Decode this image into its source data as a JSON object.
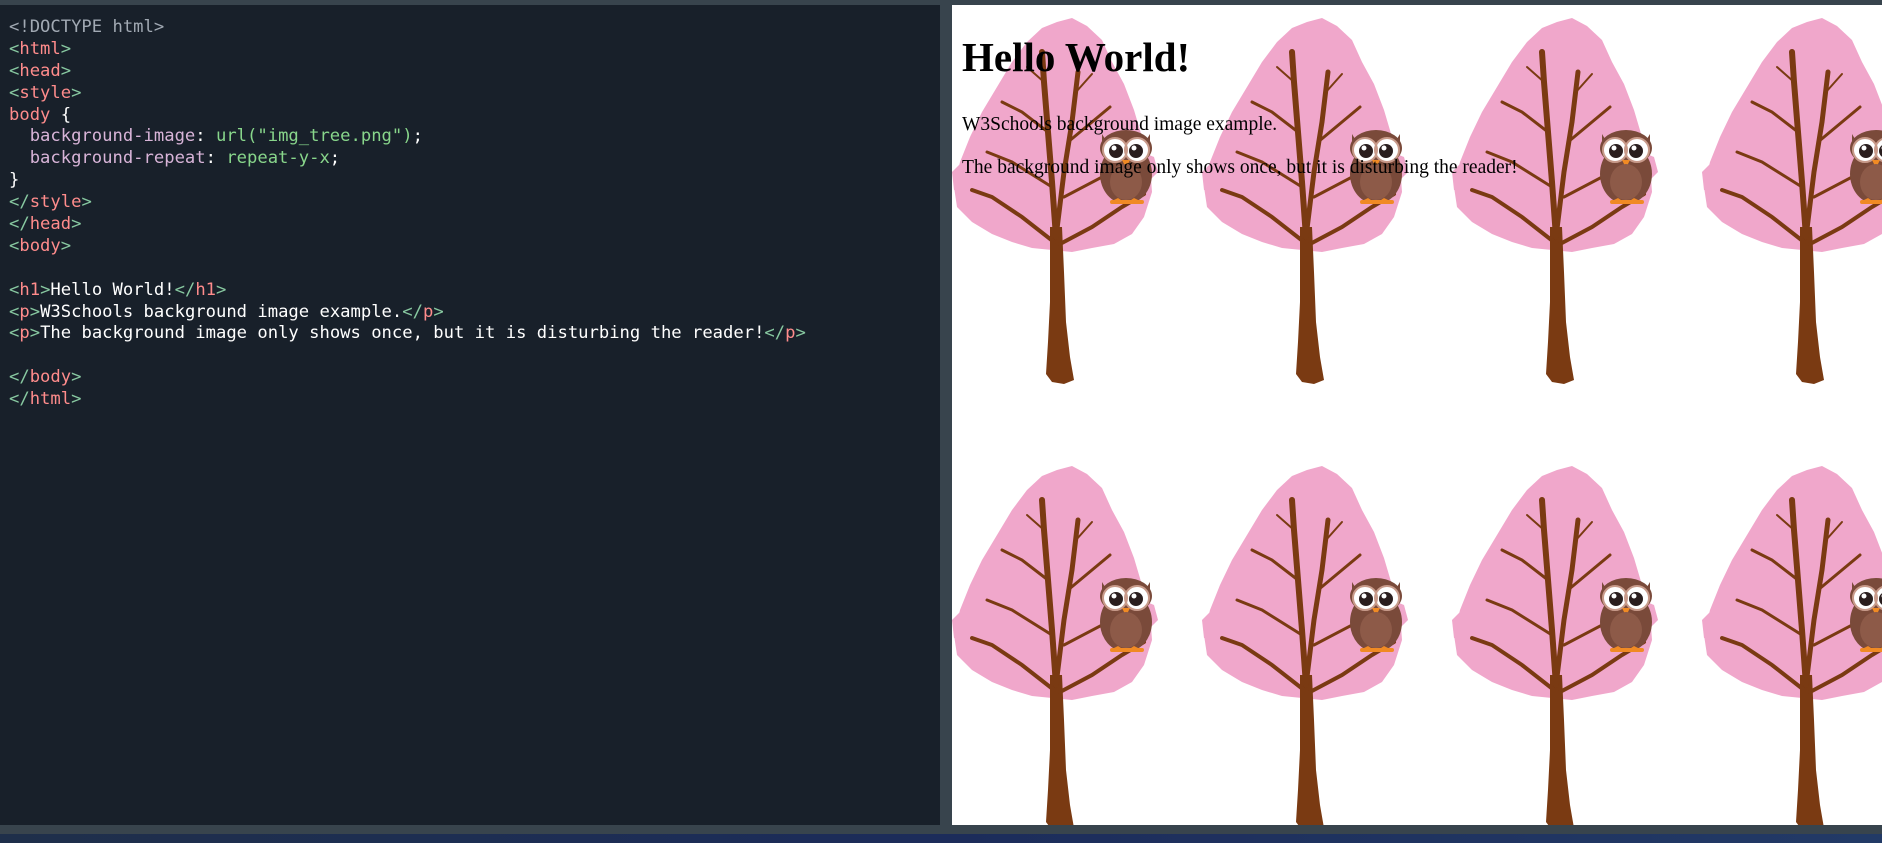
{
  "editor": {
    "lines": [
      [
        {
          "c": "t-doctype",
          "t": "<!DOCTYPE html>"
        }
      ],
      [
        {
          "c": "t-bracket",
          "t": "<"
        },
        {
          "c": "t-tag",
          "t": "html"
        },
        {
          "c": "t-bracket",
          "t": ">"
        }
      ],
      [
        {
          "c": "t-bracket",
          "t": "<"
        },
        {
          "c": "t-tag",
          "t": "head"
        },
        {
          "c": "t-bracket",
          "t": ">"
        }
      ],
      [
        {
          "c": "t-bracket",
          "t": "<"
        },
        {
          "c": "t-tag",
          "t": "style"
        },
        {
          "c": "t-bracket",
          "t": ">"
        }
      ],
      [
        {
          "c": "t-sel",
          "t": "body"
        },
        {
          "c": "t-punc",
          "t": " {"
        }
      ],
      [
        {
          "c": "t-prop",
          "t": "  background-image"
        },
        {
          "c": "t-punc",
          "t": ": "
        },
        {
          "c": "t-val",
          "t": "url("
        },
        {
          "c": "t-val",
          "t": "\"img_tree.png\""
        },
        {
          "c": "t-val",
          "t": ")"
        },
        {
          "c": "t-punc",
          "t": ";"
        }
      ],
      [
        {
          "c": "t-prop",
          "t": "  background-repeat"
        },
        {
          "c": "t-punc",
          "t": ": "
        },
        {
          "c": "t-val",
          "t": "repeat-y-x"
        },
        {
          "c": "t-punc",
          "t": ";"
        }
      ],
      [
        {
          "c": "t-punc",
          "t": "}"
        }
      ],
      [
        {
          "c": "t-bracket",
          "t": "</"
        },
        {
          "c": "t-tag",
          "t": "style"
        },
        {
          "c": "t-bracket",
          "t": ">"
        }
      ],
      [
        {
          "c": "t-bracket",
          "t": "</"
        },
        {
          "c": "t-tag",
          "t": "head"
        },
        {
          "c": "t-bracket",
          "t": ">"
        }
      ],
      [
        {
          "c": "t-bracket",
          "t": "<"
        },
        {
          "c": "t-tag",
          "t": "body"
        },
        {
          "c": "t-bracket",
          "t": ">"
        }
      ],
      [],
      [
        {
          "c": "t-bracket",
          "t": "<"
        },
        {
          "c": "t-tag",
          "t": "h1"
        },
        {
          "c": "t-bracket",
          "t": ">"
        },
        {
          "c": "t-text",
          "t": "Hello World!"
        },
        {
          "c": "t-bracket",
          "t": "</"
        },
        {
          "c": "t-tag",
          "t": "h1"
        },
        {
          "c": "t-bracket",
          "t": ">"
        }
      ],
      [
        {
          "c": "t-bracket",
          "t": "<"
        },
        {
          "c": "t-tag",
          "t": "p"
        },
        {
          "c": "t-bracket",
          "t": ">"
        },
        {
          "c": "t-text",
          "t": "W3Schools background image example."
        },
        {
          "c": "t-bracket",
          "t": "</"
        },
        {
          "c": "t-tag",
          "t": "p"
        },
        {
          "c": "t-bracket",
          "t": ">"
        }
      ],
      [
        {
          "c": "t-bracket",
          "t": "<"
        },
        {
          "c": "t-tag",
          "t": "p"
        },
        {
          "c": "t-bracket",
          "t": ">"
        },
        {
          "c": "t-text",
          "t": "The background image only shows once, but it is disturbing the reader!"
        },
        {
          "c": "t-bracket",
          "t": "</"
        },
        {
          "c": "t-tag",
          "t": "p"
        },
        {
          "c": "t-bracket",
          "t": ">"
        }
      ],
      [],
      [
        {
          "c": "t-bracket",
          "t": "</"
        },
        {
          "c": "t-tag",
          "t": "body"
        },
        {
          "c": "t-bracket",
          "t": ">"
        }
      ],
      [
        {
          "c": "t-bracket",
          "t": "</"
        },
        {
          "c": "t-tag",
          "t": "html"
        },
        {
          "c": "t-bracket",
          "t": ">"
        }
      ]
    ]
  },
  "result": {
    "heading": "Hello World!",
    "paragraph_1": "W3Schools background image example.",
    "paragraph_2": "The background image only shows once, but it is disturbing the reader!",
    "background_motif": "tree-with-owl-icon",
    "colors": {
      "blossom": "#f0a7cb",
      "trunk": "#7a3a12",
      "owl_body": "#7a4a3a",
      "owl_beak": "#f08a24"
    }
  }
}
